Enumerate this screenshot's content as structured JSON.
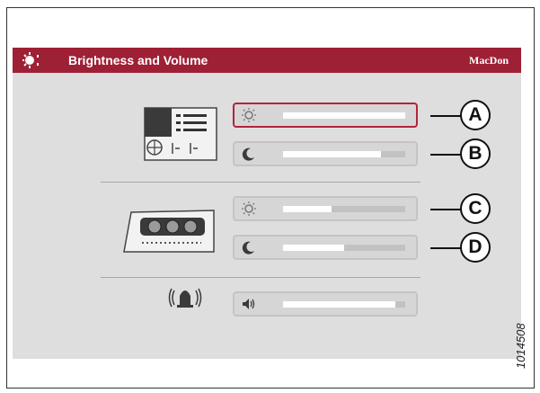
{
  "header": {
    "title": "Brightness and Volume",
    "brand": "MacDon"
  },
  "colors": {
    "header_bg": "#9e2035",
    "selected_outline": "#b0243c",
    "screen_bg": "#dedede"
  },
  "sliders": [
    {
      "id": "console-day-brightness",
      "icon": "sun-icon",
      "level_fraction": 1.0,
      "selected": true
    },
    {
      "id": "console-night-brightness",
      "icon": "moon-icon",
      "level_fraction": 0.8,
      "selected": false
    },
    {
      "id": "display-day-brightness",
      "icon": "sun-icon",
      "level_fraction": 0.4,
      "selected": false
    },
    {
      "id": "display-night-brightness",
      "icon": "moon-icon",
      "level_fraction": 0.5,
      "selected": false
    },
    {
      "id": "alarm-volume",
      "icon": "speaker-icon",
      "level_fraction": 0.92,
      "selected": false
    }
  ],
  "callouts": [
    "A",
    "B",
    "C",
    "D"
  ],
  "figure_number": "1014508"
}
